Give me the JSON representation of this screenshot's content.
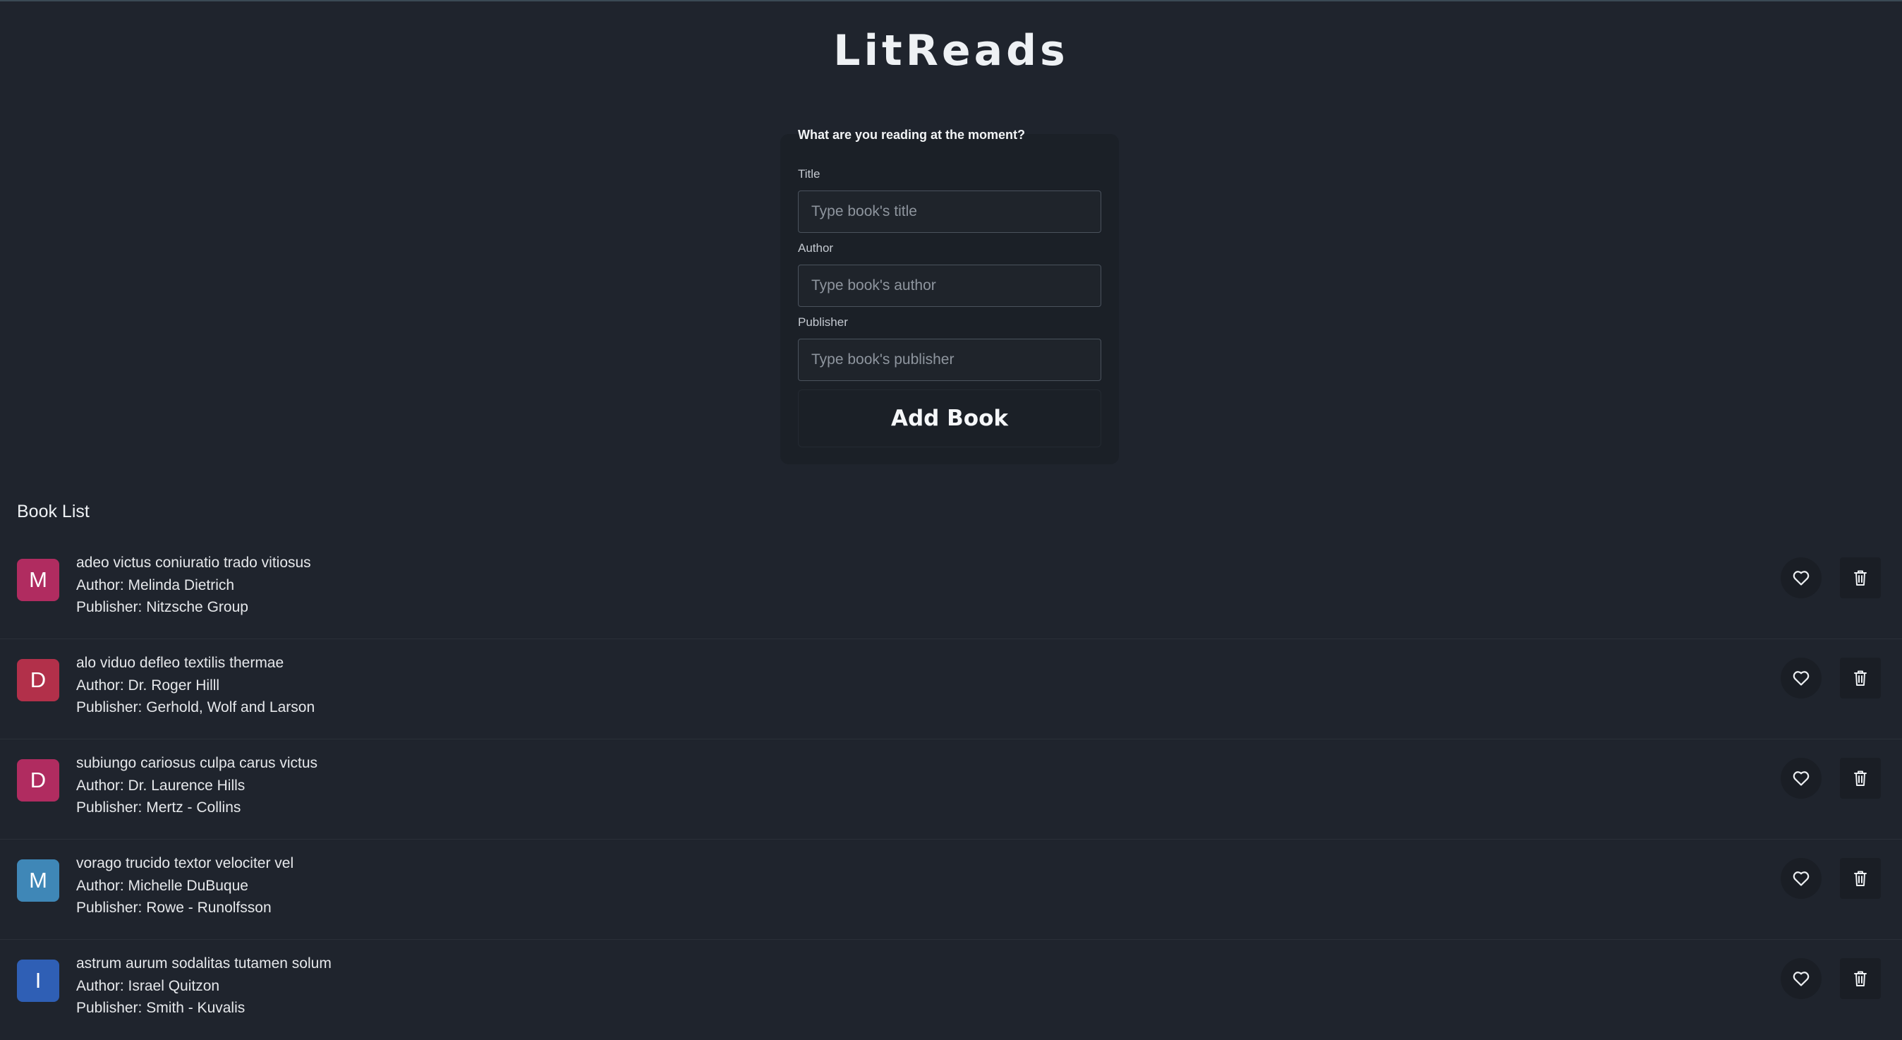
{
  "app": {
    "title": "LitReads"
  },
  "form": {
    "prompt": "What are you reading at the moment?",
    "fields": [
      {
        "label": "Title",
        "placeholder": "Type book's title",
        "value": ""
      },
      {
        "label": "Author",
        "placeholder": "Type book's author",
        "value": ""
      },
      {
        "label": "Publisher",
        "placeholder": "Type book's publisher",
        "value": ""
      }
    ],
    "submit_label": "Add Book"
  },
  "book_list": {
    "heading": "Book List",
    "items": [
      {
        "initial": "M",
        "avatar_color": "#b02c60",
        "title": "adeo victus coniuratio trado vitiosus",
        "author_line": "Author: Melinda Dietrich",
        "publisher_line": "Publisher: Nitzsche Group",
        "like_icon": "heart-outline-icon",
        "delete_icon": "trash-icon"
      },
      {
        "initial": "D",
        "avatar_color": "#b2304a",
        "title": "alo viduo defleo textilis thermae",
        "author_line": "Author: Dr. Roger Hilll",
        "publisher_line": "Publisher: Gerhold, Wolf and Larson",
        "like_icon": "heart-outline-icon",
        "delete_icon": "trash-icon"
      },
      {
        "initial": "D",
        "avatar_color": "#b02c60",
        "title": "subiungo cariosus culpa carus victus",
        "author_line": "Author: Dr. Laurence Hills",
        "publisher_line": "Publisher: Mertz - Collins",
        "like_icon": "heart-outline-icon",
        "delete_icon": "trash-icon"
      },
      {
        "initial": "M",
        "avatar_color": "#3f87b7",
        "title": "vorago trucido textor velociter vel",
        "author_line": "Author: Michelle DuBuque",
        "publisher_line": "Publisher: Rowe - Runolfsson",
        "like_icon": "heart-outline-icon",
        "delete_icon": "trash-icon"
      },
      {
        "initial": "I",
        "avatar_color": "#2f5fb5",
        "title": "astrum aurum sodalitas tutamen solum",
        "author_line": "Author: Israel Quitzon",
        "publisher_line": "Publisher: Smith - Kuvalis",
        "like_icon": "heart-outline-icon",
        "delete_icon": "trash-icon"
      }
    ]
  },
  "colors": {
    "background": "#1f242d",
    "card": "#1b2027",
    "text": "#e6e8eb"
  }
}
